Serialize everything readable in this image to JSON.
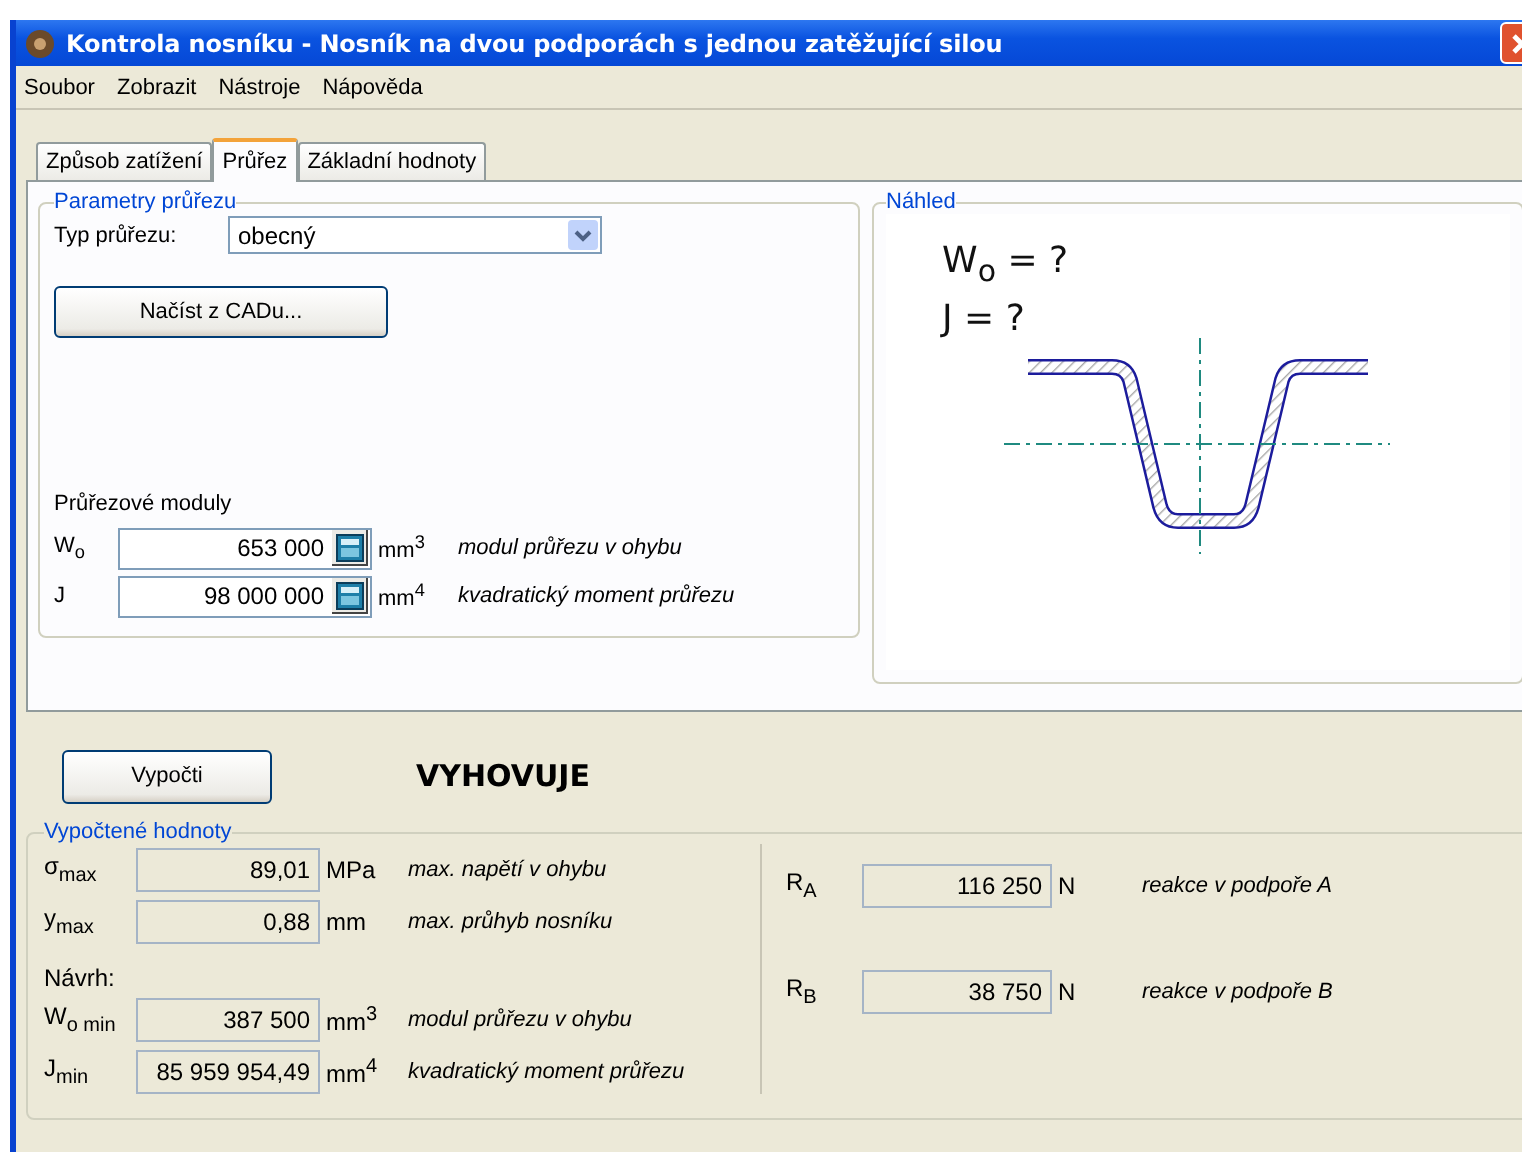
{
  "window": {
    "title": "Kontrola nosníku - Nosník na dvou podporách s jednou zatěžující silou"
  },
  "menu": [
    "Soubor",
    "Zobrazit",
    "Nástroje",
    "Nápověda"
  ],
  "tabs": [
    {
      "label": "Způsob zatížení",
      "selected": false
    },
    {
      "label": "Průřez",
      "selected": true
    },
    {
      "label": "Základní hodnoty",
      "selected": false
    }
  ],
  "parameters": {
    "title": "Parametry průřezu",
    "type_label": "Typ průřezu:",
    "type_value": "obecný",
    "load_button": "Načíst z CADu...",
    "moduli_title": "Průřezové moduly",
    "moduli": [
      {
        "symbol": "W$_{o}$",
        "value": "653 000",
        "unit": "mm$^{3}$",
        "description": "modul průřezu v ohybu"
      },
      {
        "symbol": "J",
        "value": "98 000 000",
        "unit": "mm$^{4}$",
        "description": "kvadratický moment průřezu"
      }
    ]
  },
  "preview": {
    "title": "Náhled",
    "formula_lines": [
      "W$_{o}$ = ?",
      "J = ?"
    ]
  },
  "compute_button": "Vypočti",
  "result": "VYHOVUJE",
  "computed": {
    "title": "Vypočtené hodnoty",
    "rows": [
      {
        "symbol": "σ$_{max}$",
        "value": "89,01",
        "unit": "MPa",
        "description": "max. napětí v ohybu"
      },
      {
        "symbol": "y$_{max}$",
        "value": "0,88",
        "unit": "mm",
        "description": "max. průhyb nosníku"
      }
    ],
    "design_label": "Návrh:",
    "design_rows": [
      {
        "symbol": "W$_{o min}$",
        "value": "387 500",
        "unit": "mm$^{3}$",
        "description": "modul průřezu v ohybu"
      },
      {
        "symbol": "J$_{min}$",
        "value": "85 959 954,49",
        "unit": "mm$^{4}$",
        "description": "kvadratický moment průřezu"
      }
    ],
    "reactions": [
      {
        "symbol": "R$_{A}$",
        "value": "116 250",
        "unit": "N",
        "description": "reakce v podpoře A"
      },
      {
        "symbol": "R$_{B}$",
        "value": "38 750",
        "unit": "N",
        "description": "reakce v podpoře B"
      }
    ]
  }
}
